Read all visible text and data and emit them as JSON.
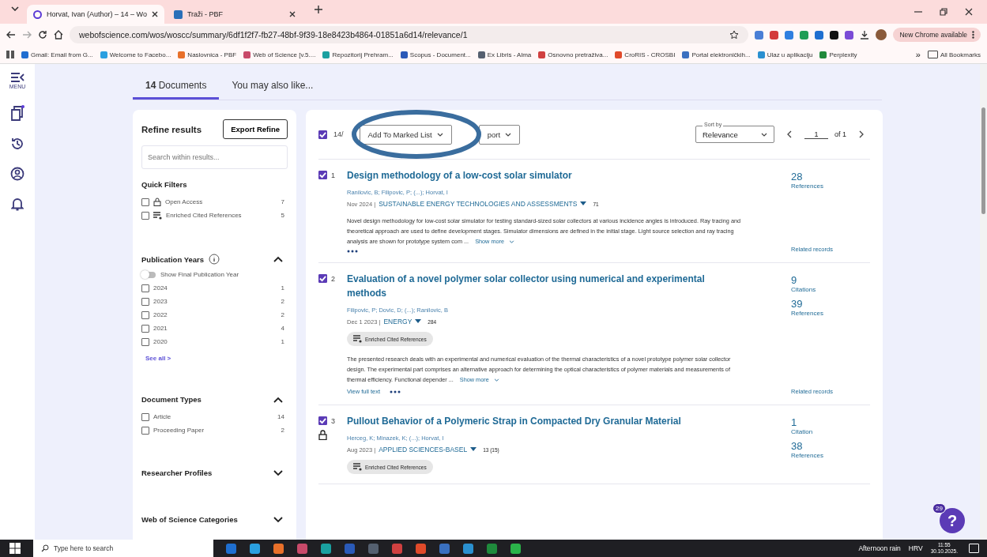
{
  "browser": {
    "tabs": [
      {
        "title": "Horvat, Ivan (Author) – 14 – Wo",
        "selected": true
      },
      {
        "title": "Traži - PBF",
        "selected": false
      }
    ],
    "url": "webofscience.com/wos/woscc/summary/6df1f2f7-fb27-48bf-9f39-18e8423b4864-01851a6d14/relevance/1",
    "update_label": "New Chrome available",
    "bookmarks": [
      "Gmail: Email from G...",
      "Welcome to Facebo...",
      "Naslovnica - PBF",
      "Web of Science [v.5....",
      "Repozitorij Prehram...",
      "Scopus - Document...",
      "Ex Libris - Alma",
      "Osnovno pretraživa...",
      "CroRIS - CROSBI",
      "Portal elektroničkih...",
      "Ulaz u aplikaciju",
      "Perplexity"
    ],
    "overflow": "»",
    "all_bookmarks": "All Bookmarks"
  },
  "sidebar": {
    "menu_label": "MENU"
  },
  "page_tabs": [
    {
      "label": "**14** Documents",
      "selected": true
    },
    {
      "label": "You may also like...",
      "selected": false
    }
  ],
  "refine": {
    "title": "Refine results",
    "export_button": "Export Refine",
    "search_placeholder": "Search within results...",
    "sections": [
      {
        "title": "Quick Filters",
        "kind": "plain",
        "items": [
          {
            "label": "Open Access",
            "count": "7",
            "checked": false,
            "kind": "open_access"
          },
          {
            "label": "Enriched Cited References",
            "count": "5",
            "checked": false,
            "kind": "enriched"
          }
        ]
      },
      {
        "title": "Publication Years",
        "kind": "collapsible",
        "expanded": true,
        "info": true,
        "toggle": {
          "label": "Show Final Publication Year",
          "on": false
        },
        "items": [
          {
            "label": "2024",
            "count": "1",
            "checked": false
          },
          {
            "label": "2023",
            "count": "2",
            "checked": false
          },
          {
            "label": "2022",
            "count": "2",
            "checked": false
          },
          {
            "label": "2021",
            "count": "4",
            "checked": false
          },
          {
            "label": "2020",
            "count": "1",
            "checked": false
          }
        ],
        "see_all": "See all >"
      },
      {
        "title": "Document Types",
        "kind": "collapsible",
        "expanded": true,
        "items": [
          {
            "label": "Article",
            "count": "14",
            "checked": false
          },
          {
            "label": "Proceeding Paper",
            "count": "2",
            "checked": false
          }
        ]
      },
      {
        "title": "Researcher Profiles",
        "kind": "collapsible",
        "expanded": false
      },
      {
        "title": "Web of Science Categories",
        "kind": "collapsible",
        "expanded": false
      }
    ]
  },
  "toolbar": {
    "select_all_checked": true,
    "count": "14/",
    "add_button": "Add To Marked List",
    "export_button": "port",
    "sort_label": "Sort by",
    "sort_value": "Relevance",
    "page": "1",
    "page_total": "of 1",
    "highlight_ellipse": true
  },
  "results": [
    {
      "number": "1",
      "checked": true,
      "open_access": false,
      "title": "Design methodology of a low-cost solar simulator",
      "authors": "Ranilovic, B; Filipovic, P; (...); Horvat, I",
      "date": "Nov 2024 |",
      "journal": "SUSTAINABLE ENERGY TECHNOLOGIES AND ASSESSMENTS",
      "journal_metric": "71",
      "enriched": false,
      "abstract": "Novel design methodology for low-cost solar simulator for testing standard-sized solar collectors at various incidence angles is introduced. Ray tracing and theoretical approach are used to define development stages. Simulator dimensions are defined in the initial stage. Light source selection and ray tracing analysis are shown for prototype system com ...",
      "show_more": "Show more",
      "metrics": [
        {
          "value": "28",
          "label": "References"
        }
      ],
      "related": "Related records"
    },
    {
      "number": "2",
      "checked": true,
      "open_access": false,
      "title": "Evaluation of a novel polymer solar collector using numerical and experimental methods",
      "authors": "Filipovic, P; Dovic, D; (...); Ranilovic, B",
      "date": "Dec 1 2023 |",
      "journal": "ENERGY",
      "journal_metric": "284",
      "enriched": true,
      "enriched_label": "Enriched Cited References",
      "abstract": "The presented research deals with an experimental and numerical evaluation of the thermal characteristics of a novel prototype polymer solar collector design. The experimental part comprises an alternative approach for determining the optical characteristics of polymer materials and measurements of thermal efficiency. Functional depender ...",
      "show_more": "Show more",
      "full_text": "View full text",
      "metrics": [
        {
          "value": "9",
          "label": "Citations"
        },
        {
          "value": "39",
          "label": "References"
        }
      ],
      "related": "Related records"
    },
    {
      "number": "3",
      "checked": true,
      "open_access": true,
      "title": "Pullout Behavior of a Polymeric Strap in Compacted Dry Granular Material",
      "authors": "Herceg, K; Minazek, K; (...); Horvat, I",
      "date": "Aug 2023 |",
      "journal": "APPLIED SCIENCES-BASEL",
      "journal_metric": "13 (15)",
      "enriched": true,
      "enriched_label": "Enriched Cited References",
      "metrics": [
        {
          "value": "1",
          "label": "Citation"
        },
        {
          "value": "38",
          "label": "References"
        }
      ]
    }
  ],
  "help": {
    "badge": "29",
    "label": "?"
  },
  "taskbar": {
    "search_placeholder": "Type here to search",
    "weather": "Afternoon rain",
    "language": "HRV",
    "time": "11:55",
    "date": "30.10.2025."
  }
}
